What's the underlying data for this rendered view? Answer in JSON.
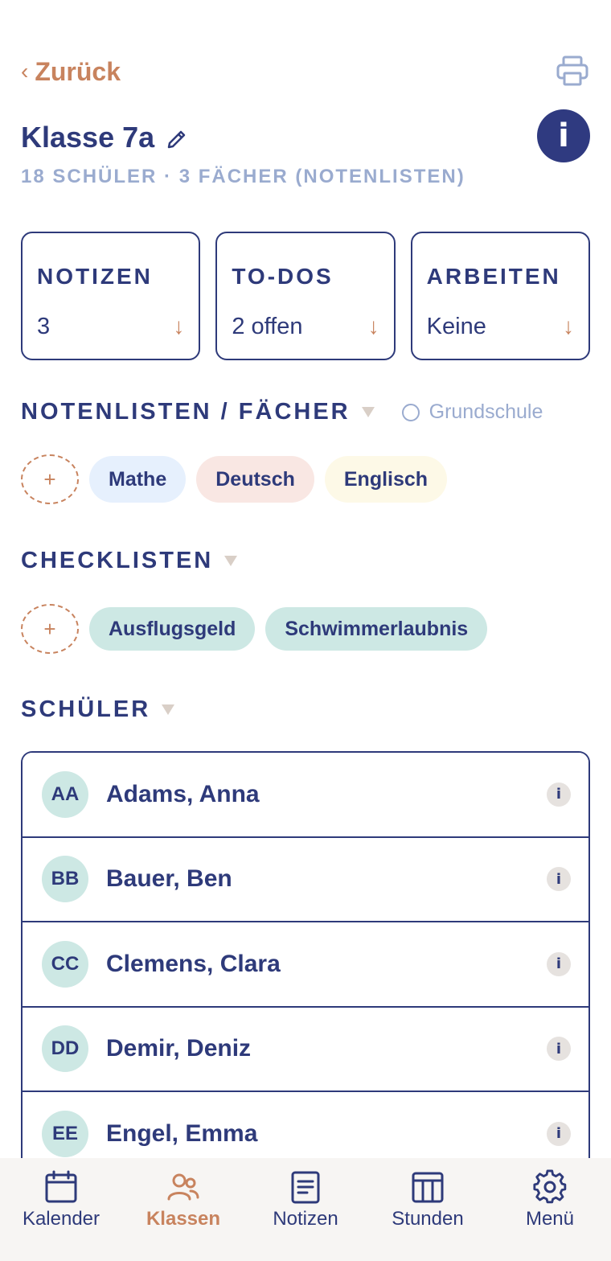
{
  "header": {
    "back_label": "Zurück",
    "back_icon": "chevron-left-icon",
    "print_icon": "printer-icon"
  },
  "class_info": {
    "title": "Klasse 7a",
    "subtitle": "18 SCHÜLER · 3 FÄCHER (NOTENLISTEN)",
    "info_label": "i"
  },
  "cards": [
    {
      "title": "NOTIZEN",
      "value": "3",
      "arrow": "↓"
    },
    {
      "title": "TO-DOS",
      "value": "2 offen",
      "arrow": "↓"
    },
    {
      "title": "ARBEITEN",
      "value": "Keine",
      "arrow": "↓"
    }
  ],
  "grades_section": {
    "title": "NOTENLISTEN / FÄCHER",
    "radio_label": "Grundschule",
    "add_label": "+",
    "subjects": [
      {
        "label": "Mathe",
        "color": "#e6f0fd"
      },
      {
        "label": "Deutsch",
        "color": "#f9e7e3"
      },
      {
        "label": "Englisch",
        "color": "#fdf9e7"
      }
    ]
  },
  "checklists_section": {
    "title": "CHECKLISTEN",
    "add_label": "+",
    "items": [
      {
        "label": "Ausflugsgeld",
        "color": "#cde8e4"
      },
      {
        "label": "Schwimmerlaubnis",
        "color": "#cde8e4"
      }
    ]
  },
  "students_section": {
    "title": "SCHÜLER",
    "students": [
      {
        "initials": "AA",
        "name": "Adams, Anna",
        "info": "i"
      },
      {
        "initials": "BB",
        "name": "Bauer, Ben",
        "info": "i"
      },
      {
        "initials": "CC",
        "name": "Clemens, Clara",
        "info": "i"
      },
      {
        "initials": "DD",
        "name": "Demir, Deniz",
        "info": "i"
      },
      {
        "initials": "EE",
        "name": "Engel, Emma",
        "info": "i"
      }
    ]
  },
  "bottom_nav": [
    {
      "label": "Kalender",
      "icon": "calendar-icon",
      "active": false
    },
    {
      "label": "Klassen",
      "icon": "people-icon",
      "active": true
    },
    {
      "label": "Notizen",
      "icon": "document-icon",
      "active": false
    },
    {
      "label": "Stunden",
      "icon": "timetable-icon",
      "active": false
    },
    {
      "label": "Menü",
      "icon": "gear-icon",
      "active": false
    }
  ],
  "colors": {
    "primary": "#2e3a7a",
    "accent": "#c8835e",
    "muted": "#9aabcf"
  }
}
